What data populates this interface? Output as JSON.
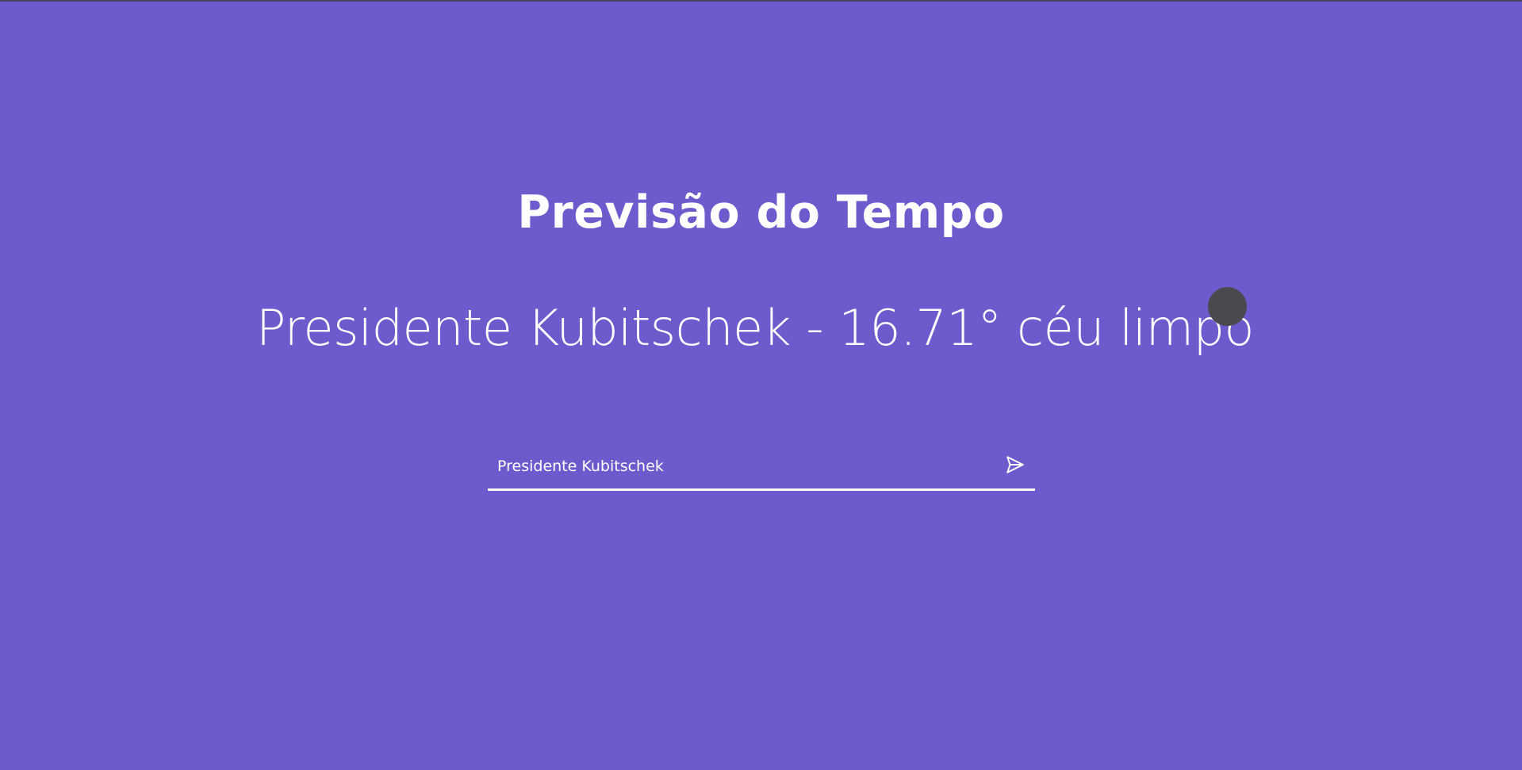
{
  "page": {
    "title": "Previsão do Tempo"
  },
  "weather": {
    "summary": "Presidente Kubitschek - 16.71° céu limpo",
    "icon": "weather-condition-icon"
  },
  "search": {
    "value": "Presidente Kubitschek",
    "submit_icon": "send-icon"
  },
  "colors": {
    "background": "#6c5bcd",
    "text": "#ffffff",
    "icon_placeholder": "#4a4a4e"
  }
}
